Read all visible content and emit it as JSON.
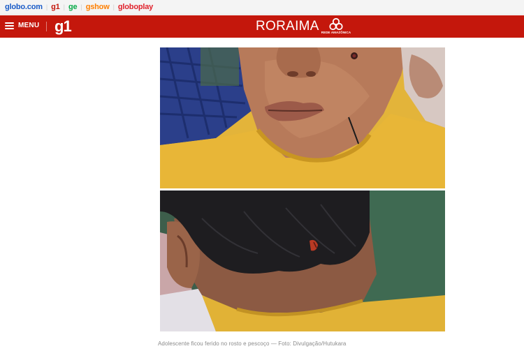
{
  "topbar": {
    "links": [
      {
        "label": "globo.com",
        "color": "#1a5bc7"
      },
      {
        "label": "g1",
        "color": "#c4170c"
      },
      {
        "label": "ge",
        "color": "#06aa48"
      },
      {
        "label": "gshow",
        "color": "#ff7f00"
      },
      {
        "label": "globoplay",
        "color": "#e0222c"
      }
    ]
  },
  "header": {
    "menu_label": "MENU",
    "logo": "g1",
    "region": "RORAIMA",
    "network_label": "REDE AMAZÔNICA",
    "background": "#c4170c"
  },
  "article": {
    "caption": "Adolescente ficou ferido no rosto e pescoço — Foto: Divulgação/Hutukara"
  }
}
